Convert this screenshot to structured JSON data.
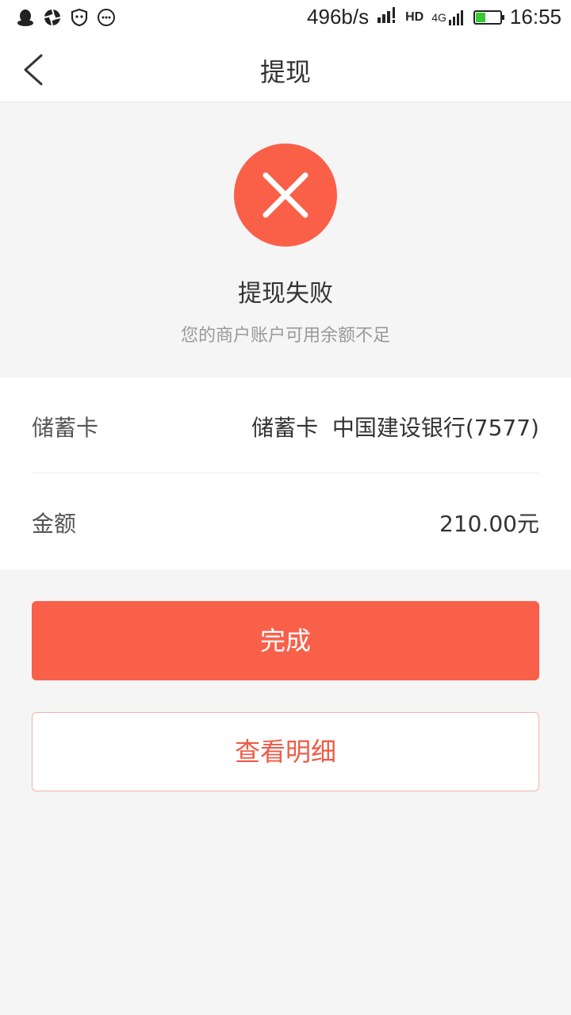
{
  "status_bar": {
    "network_speed": "496b/s",
    "network_type": "4G",
    "hd_label": "HD",
    "time": "16:55",
    "battery_percent": 40,
    "left_icons": [
      "qq-icon",
      "aperture-icon",
      "shield-face-icon",
      "chat-bubble-icon"
    ]
  },
  "navbar": {
    "title": "提现",
    "back_icon": "chevron-left-icon"
  },
  "result": {
    "icon": "close-icon",
    "icon_color": "#fa5f48",
    "title": "提现失败",
    "message": "您的商户账户可用余额不足"
  },
  "details": {
    "card_label": "储蓄卡",
    "card_value": "储蓄卡  中国建设银行(7577)",
    "amount_label": "金额",
    "amount_value": "210.00元"
  },
  "actions": {
    "done_label": "完成",
    "details_label": "查看明细"
  },
  "colors": {
    "accent": "#f9604a",
    "background": "#f5f5f5"
  }
}
